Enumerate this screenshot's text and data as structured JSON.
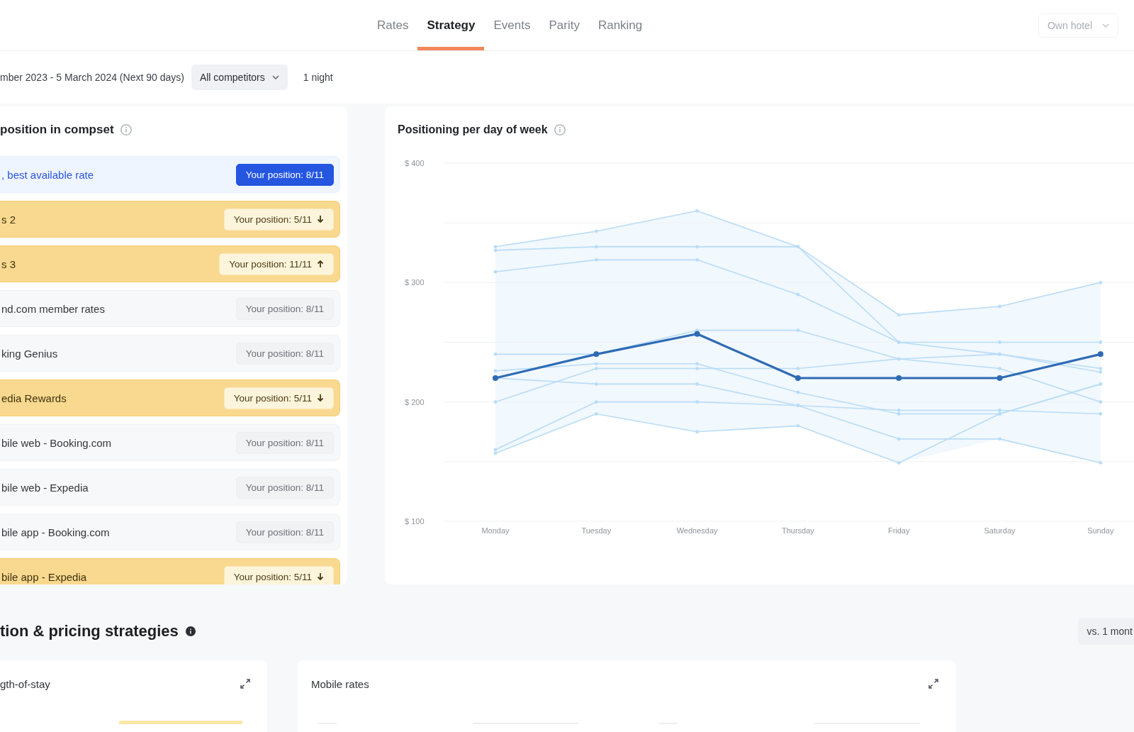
{
  "nav": {
    "tabs": [
      {
        "label": "Rates",
        "selected": false
      },
      {
        "label": "Strategy",
        "selected": true
      },
      {
        "label": "Events",
        "selected": false
      },
      {
        "label": "Parity",
        "selected": false
      },
      {
        "label": "Ranking",
        "selected": false
      }
    ],
    "hotel_select": {
      "label": "Own hotel",
      "disabled": true
    }
  },
  "filters": {
    "date_range": "mber 2023 - 5 March 2024 (Next 90 days)",
    "competitors": "All competitors",
    "length_of_stay": "1 night"
  },
  "position_panel": {
    "title": "position in compset",
    "rows": [
      {
        "label": ", best available rate",
        "badge": "Your position: 8/11",
        "kind": "own"
      },
      {
        "label": "s 2",
        "badge": "Your position: 5/11",
        "kind": "down"
      },
      {
        "label": "s 3",
        "badge": "Your position: 11/11",
        "kind": "up"
      },
      {
        "label": "nd.com member rates",
        "badge": "Your position: 8/11",
        "kind": "normal"
      },
      {
        "label": "king Genius",
        "badge": "Your position: 8/11",
        "kind": "normal"
      },
      {
        "label": "edia Rewards",
        "badge": "Your position: 5/11",
        "kind": "down"
      },
      {
        "label": "bile web - Booking.com",
        "badge": "Your position: 8/11",
        "kind": "normal"
      },
      {
        "label": "bile web - Expedia",
        "badge": "Your position: 8/11",
        "kind": "normal"
      },
      {
        "label": "bile app - Booking.com",
        "badge": "Your position: 8/11",
        "kind": "normal"
      },
      {
        "label": "bile app - Expedia",
        "badge": "Your position: 5/11",
        "kind": "down"
      }
    ]
  },
  "weekday_chart": {
    "title": "Positioning per day of week",
    "chart_data": {
      "type": "line",
      "categories": [
        "Monday",
        "Tuesday",
        "Wednesday",
        "Thursday",
        "Friday",
        "Saturday",
        "Sunday"
      ],
      "ylim": [
        100,
        400
      ],
      "yticks": [
        {
          "value": 100,
          "label": "$ 100"
        },
        {
          "value": 200,
          "label": "$ 200"
        },
        {
          "value": 300,
          "label": "$ 300"
        },
        {
          "value": 400,
          "label": "$ 400"
        }
      ],
      "series": [
        {
          "color": "#2e6bb4",
          "marker": true,
          "values": [
            220,
            240,
            257,
            220,
            220,
            220,
            240
          ]
        },
        {
          "color": "#b9dcf7",
          "marker": true,
          "values": [
            330,
            343,
            360,
            330,
            273,
            280,
            300
          ]
        },
        {
          "color": "#b9dcf7",
          "marker": true,
          "values": [
            327,
            330,
            330,
            330,
            250,
            250,
            250
          ]
        },
        {
          "color": "#b9dcf7",
          "marker": true,
          "values": [
            309,
            319,
            319,
            290,
            250,
            240,
            225
          ]
        },
        {
          "color": "#b9dcf7",
          "marker": true,
          "values": [
            240,
            240,
            260,
            260,
            236,
            240,
            228
          ]
        },
        {
          "color": "#b9dcf7",
          "marker": true,
          "values": [
            226,
            232,
            232,
            208,
            190,
            190,
            215
          ]
        },
        {
          "color": "#b9dcf7",
          "marker": true,
          "values": [
            220,
            215,
            215,
            197,
            169,
            169,
            149
          ]
        },
        {
          "color": "#b9dcf7",
          "marker": true,
          "values": [
            200,
            228,
            228,
            228,
            236,
            228,
            200
          ]
        },
        {
          "color": "#b9dcf7",
          "marker": true,
          "values": [
            160,
            200,
            200,
            197,
            193,
            193,
            190
          ]
        },
        {
          "color": "#b9dcf7",
          "marker": true,
          "values": [
            157,
            190,
            175,
            180,
            149,
            190,
            215
          ]
        }
      ]
    }
  },
  "strategies": {
    "title": "tion & pricing strategies",
    "compare": "vs. 1 mont",
    "cards": [
      {
        "title": "gth-of-stay",
        "kind": "bars"
      },
      {
        "title": "Mobile rates",
        "kind": "lines"
      }
    ]
  }
}
